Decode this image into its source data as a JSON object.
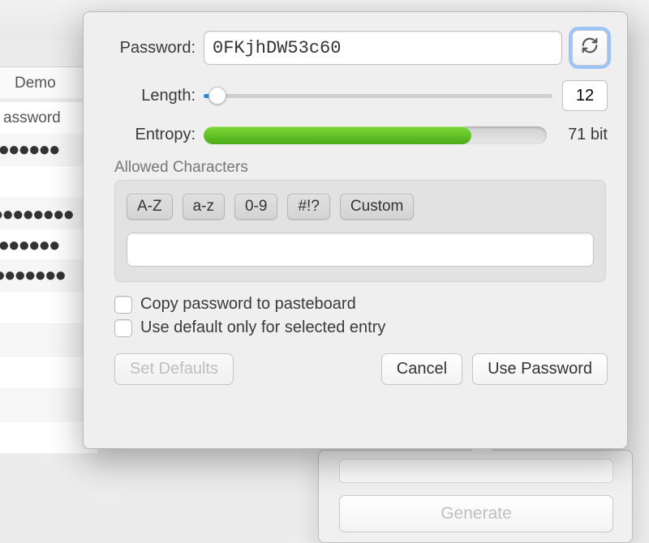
{
  "background": {
    "sidebar_header": "Demo",
    "column_header": "assword"
  },
  "generate_popover": {
    "button_label": "Generate"
  },
  "password_row": {
    "label": "Password:",
    "value": "0FKjhDW53c60"
  },
  "length_row": {
    "label": "Length:",
    "value": "12",
    "slider_percent": 4
  },
  "entropy_row": {
    "label": "Entropy:",
    "fill_percent": 78,
    "text": "71 bit"
  },
  "allowed": {
    "group_label": "Allowed Characters",
    "buttons": {
      "upper": "A-Z",
      "lower": "a-z",
      "digits": "0-9",
      "symbols": "#!?",
      "custom": "Custom"
    },
    "custom_value": ""
  },
  "checks": {
    "copy": "Copy password to pasteboard",
    "default_selected": "Use default only for selected entry"
  },
  "buttons": {
    "set_defaults": "Set Defaults",
    "cancel": "Cancel",
    "use_password": "Use Password"
  }
}
